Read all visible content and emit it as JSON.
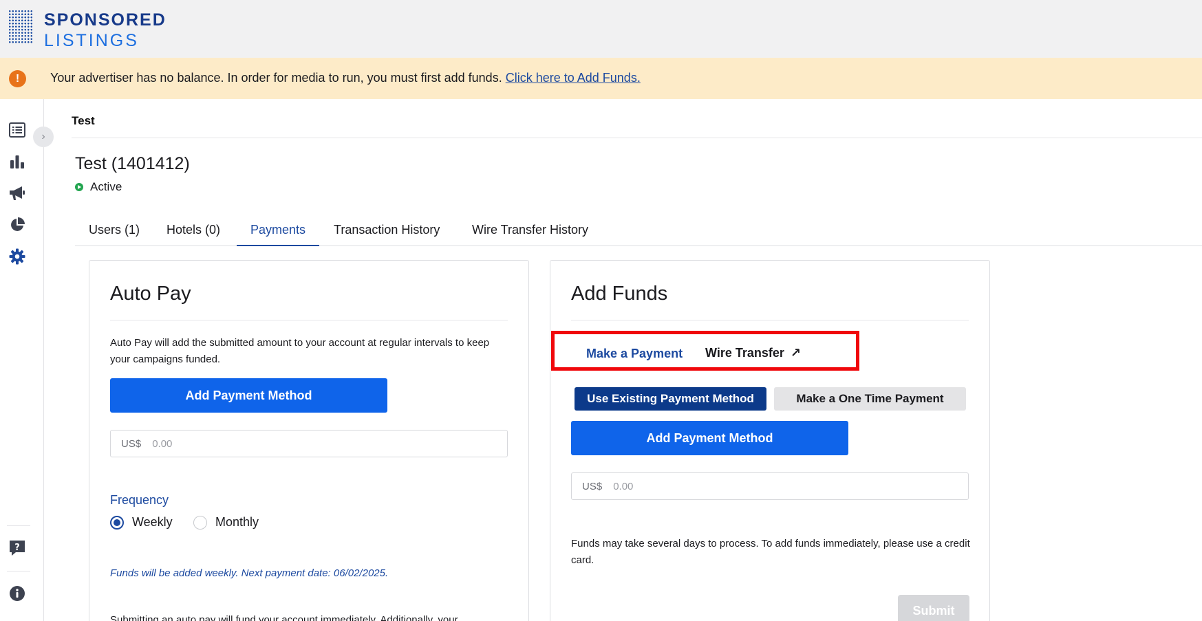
{
  "brand": {
    "line1": "SPONSORED",
    "line2": "LISTINGS"
  },
  "alert": {
    "icon": "!",
    "message": "Your advertiser has no balance. In order for media to run, you must first add funds.",
    "link": "Click here to Add Funds."
  },
  "sidebar": {
    "items": [
      {
        "icon": "list-icon"
      },
      {
        "icon": "bar-chart-icon"
      },
      {
        "icon": "megaphone-icon"
      },
      {
        "icon": "pie-chart-icon"
      },
      {
        "icon": "gear-icon",
        "active": true
      }
    ],
    "bottom": [
      {
        "icon": "help-icon"
      },
      {
        "icon": "info-icon"
      }
    ],
    "expand": "›"
  },
  "breadcrumb": "Test",
  "page": {
    "title": "Test (1401412)",
    "status": "Active"
  },
  "tabs": [
    {
      "label": "Users (1)"
    },
    {
      "label": "Hotels (0)"
    },
    {
      "label": "Payments",
      "active": true
    },
    {
      "label": "Transaction History"
    },
    {
      "label": "Wire Transfer History"
    }
  ],
  "auto_pay": {
    "title": "Auto Pay",
    "description": "Auto Pay will add the submitted amount to your account at regular intervals to keep your campaigns funded.",
    "add_payment_label": "Add Payment Method",
    "currency_prefix": "US$",
    "amount_placeholder": "0.00",
    "frequency_label": "Frequency",
    "options": [
      {
        "label": "Weekly",
        "checked": true
      },
      {
        "label": "Monthly",
        "checked": false
      }
    ],
    "note": "Funds will be added weekly. Next payment date: 06/02/2025.",
    "bottom_text": "Submitting an auto pay will fund your account immediately. Additionally, your"
  },
  "add_funds": {
    "title": "Add Funds",
    "subtabs": {
      "make_payment": "Make a Payment",
      "wire_transfer": "Wire Transfer",
      "wire_icon": "↗"
    },
    "segments": {
      "existing": "Use Existing Payment Method",
      "one_time": "Make a One Time Payment"
    },
    "add_payment_label": "Add Payment Method",
    "currency_prefix": "US$",
    "amount_placeholder": "0.00",
    "note": "Funds may take several days to process. To add funds immediately, please use a credit card.",
    "submit_label": "Submit"
  },
  "colors": {
    "accent": "#1d4aa0",
    "primary_button": "#0f64ea",
    "alert_bg": "#fdebc8",
    "highlight": "#f0080b"
  }
}
